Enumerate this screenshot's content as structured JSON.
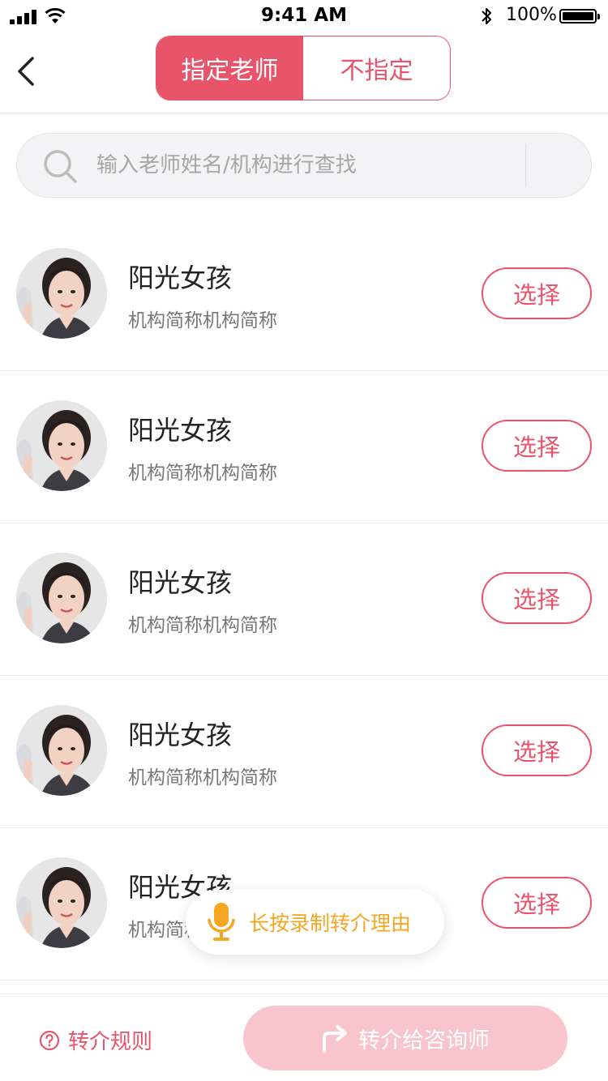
{
  "status_bar": {
    "time": "9:41 AM",
    "battery_percent": "100%"
  },
  "nav": {
    "back_icon": "chevron-left-icon",
    "tabs": [
      {
        "label": "指定老师",
        "active": true
      },
      {
        "label": "不指定",
        "active": false
      }
    ]
  },
  "search": {
    "icon": "search-icon",
    "placeholder": "输入老师姓名/机构进行查找"
  },
  "teachers": [
    {
      "name": "阳光女孩",
      "org": "机构简称机构简称",
      "button": "选择"
    },
    {
      "name": "阳光女孩",
      "org": "机构简称机构简称",
      "button": "选择"
    },
    {
      "name": "阳光女孩",
      "org": "机构简称机构简称",
      "button": "选择"
    },
    {
      "name": "阳光女孩",
      "org": "机构简称机构简称",
      "button": "选择"
    },
    {
      "name": "阳光女孩",
      "org": "机构简称机构简称",
      "button": "选择"
    }
  ],
  "voice": {
    "icon": "microphone-icon",
    "label": "长按录制转介理由"
  },
  "bottom": {
    "rules_icon": "help-circle-icon",
    "rules_label": "转介规则",
    "refer_icon": "share-arrow-icon",
    "refer_label": "转介给咨询师"
  },
  "colors": {
    "accent": "#e8546a",
    "accent_disabled": "#f8c5cc",
    "voice": "#f5a623"
  }
}
